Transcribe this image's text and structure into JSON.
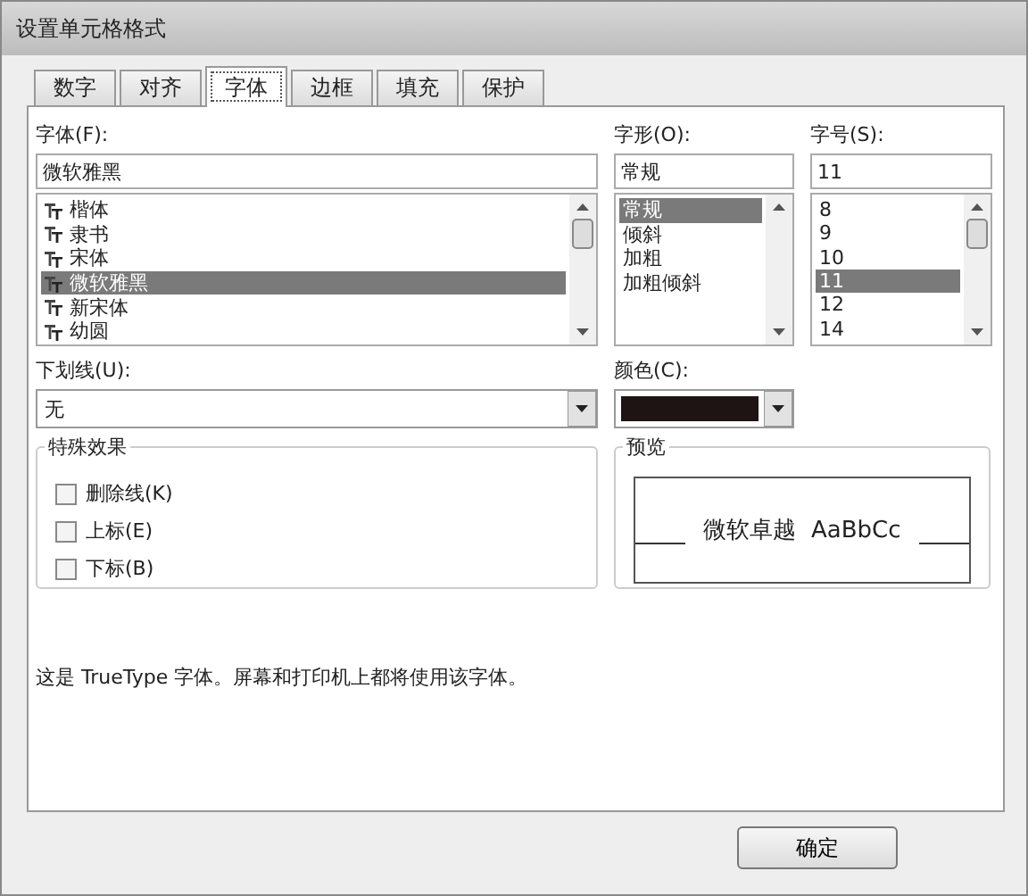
{
  "window": {
    "title": "设置单元格格式"
  },
  "tabs": [
    {
      "label": "数字",
      "selected": false
    },
    {
      "label": "对齐",
      "selected": false
    },
    {
      "label": "字体",
      "selected": true
    },
    {
      "label": "边框",
      "selected": false
    },
    {
      "label": "填充",
      "selected": false
    },
    {
      "label": "保护",
      "selected": false
    }
  ],
  "font": {
    "label": "字体(F):",
    "value": "微软雅黑",
    "items": [
      {
        "label": "楷体",
        "selected": false
      },
      {
        "label": "隶书",
        "selected": false
      },
      {
        "label": "宋体",
        "selected": false
      },
      {
        "label": "微软雅黑",
        "selected": true
      },
      {
        "label": "新宋体",
        "selected": false
      },
      {
        "label": "幼圆",
        "selected": false
      }
    ]
  },
  "style": {
    "label": "字形(O):",
    "value": "常规",
    "items": [
      {
        "label": "常规",
        "selected": true
      },
      {
        "label": "倾斜",
        "selected": false
      },
      {
        "label": "加粗",
        "selected": false
      },
      {
        "label": "加粗倾斜",
        "selected": false
      }
    ]
  },
  "size": {
    "label": "字号(S):",
    "value": "11",
    "items": [
      {
        "label": "8",
        "selected": false
      },
      {
        "label": "9",
        "selected": false
      },
      {
        "label": "10",
        "selected": false
      },
      {
        "label": "11",
        "selected": true
      },
      {
        "label": "12",
        "selected": false
      },
      {
        "label": "14",
        "selected": false
      }
    ]
  },
  "underline": {
    "label": "下划线(U):",
    "value": "无"
  },
  "color": {
    "label": "颜色(C):",
    "color": "#1e1414"
  },
  "effects": {
    "title": "特殊效果",
    "items": [
      {
        "label": "删除线(K)",
        "checked": false
      },
      {
        "label": "上标(E)",
        "checked": false
      },
      {
        "label": "下标(B)",
        "checked": false
      }
    ]
  },
  "preview": {
    "title": "预览",
    "sample": "微软卓越  AaBbCc"
  },
  "description": "这是 TrueType 字体。屏幕和打印机上都将使用该字体。",
  "buttons": [
    "确定"
  ]
}
